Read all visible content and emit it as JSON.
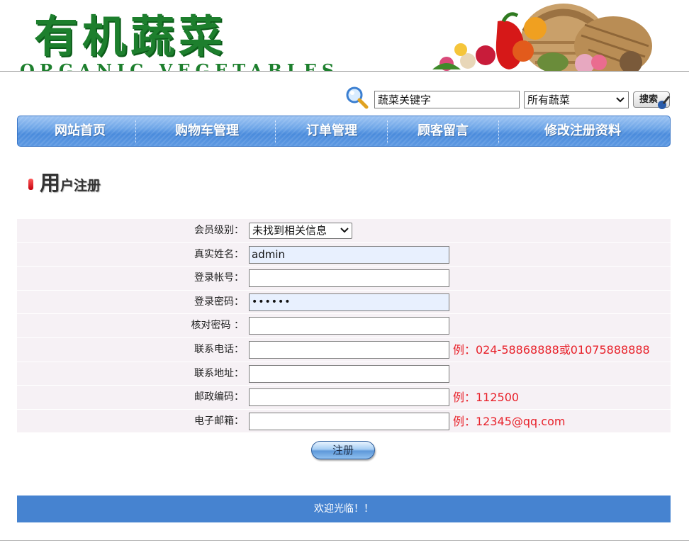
{
  "banner": {
    "title": "有机蔬菜",
    "subtitle": "ORGANIC VEGETABLES"
  },
  "search": {
    "input_value": "蔬菜关键字",
    "category_selected": "所有蔬菜",
    "button_label": "搜索"
  },
  "nav": {
    "items": [
      "网站首页",
      "购物车管理",
      "订单管理",
      "顾客留言",
      "修改注册资料"
    ]
  },
  "section": {
    "title_first": "用",
    "title_rest": "户注册"
  },
  "form": {
    "member_level": {
      "label": "会员级别：",
      "selected": "未找到相关信息"
    },
    "real_name": {
      "label": "真实姓名：",
      "value": "admin"
    },
    "account": {
      "label": "登录帐号：",
      "value": ""
    },
    "password": {
      "label": "登录密码：",
      "value": "••••••"
    },
    "confirm_password": {
      "label": "核对密码 ：",
      "value": ""
    },
    "phone": {
      "label": "联系电话：",
      "value": "",
      "hint": "例：024-58868888或01075888888"
    },
    "address": {
      "label": "联系地址：",
      "value": ""
    },
    "postcode": {
      "label": "邮政编码：",
      "value": "",
      "hint": "例：112500"
    },
    "email": {
      "label": "电子邮箱：",
      "value": "",
      "hint": "例：12345@qq.com"
    }
  },
  "submit_label": "注册",
  "footer": {
    "text": "欢迎光临！！"
  },
  "colors": {
    "brand_green": "#1d7f2d",
    "nav_blue": "#4a8bdc",
    "footer_blue": "#4683d0",
    "hint_red": "#e8212a",
    "row_bg": "#f6f1f5"
  },
  "icons": [
    "magnifier-icon",
    "chevron-down-icon",
    "pen-icon",
    "red-bullet-icon",
    "vegetable-basket-image"
  ]
}
